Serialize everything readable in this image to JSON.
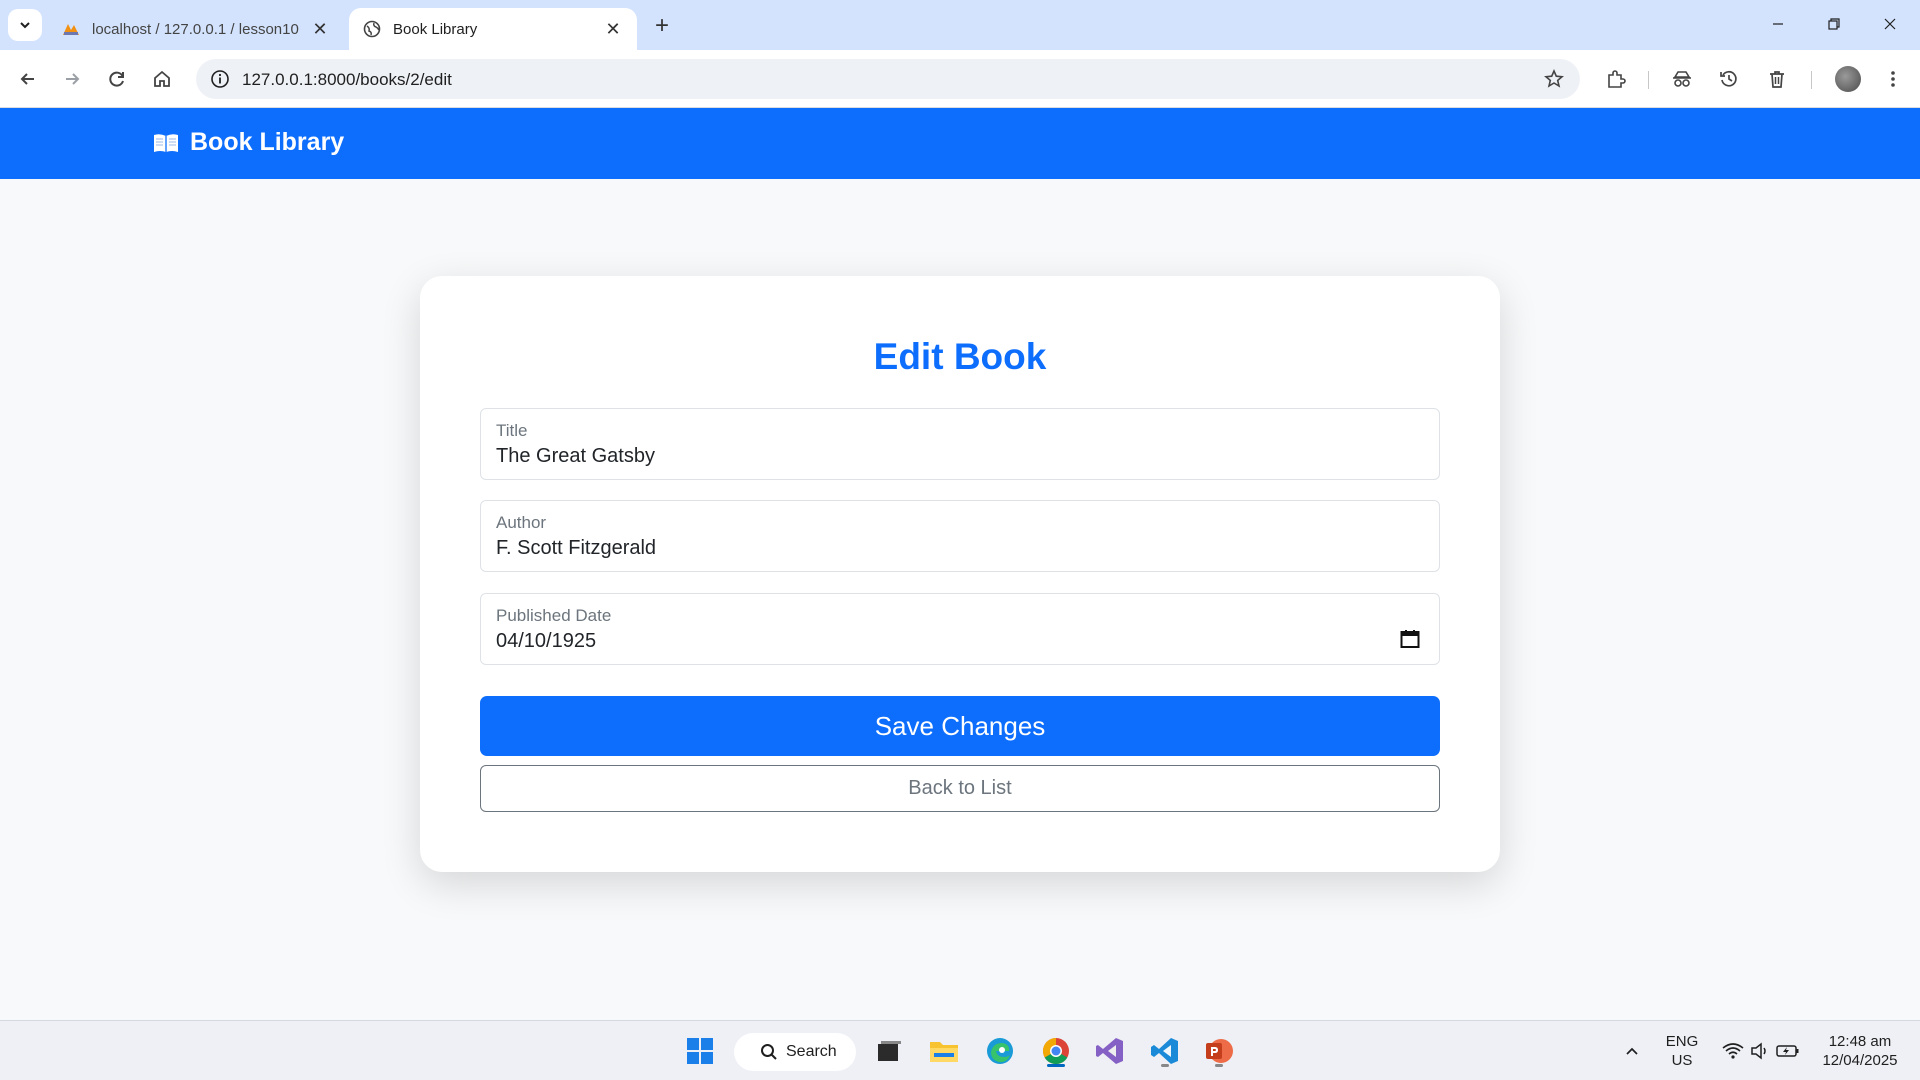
{
  "browser": {
    "tabs": [
      {
        "title": "localhost / 127.0.0.1 / lesson10",
        "active": false
      },
      {
        "title": "Book Library",
        "active": true
      }
    ],
    "url": "127.0.0.1:8000/books/2/edit"
  },
  "navbar": {
    "brand": "Book Library",
    "brand_icon": "open-book-icon",
    "color": "#0d6efd"
  },
  "form": {
    "heading": "Edit Book",
    "fields": [
      {
        "label": "Title",
        "value": "The Great Gatsby"
      },
      {
        "label": "Author",
        "value": "F. Scott Fitzgerald"
      },
      {
        "label": "Published Date",
        "value": "04/10/1925"
      }
    ],
    "save_label": "Save Changes",
    "back_label": "Back to List"
  },
  "taskbar": {
    "search_label": "Search",
    "language": "ENG",
    "region": "US",
    "time": "12:48 am",
    "date": "12/04/2025"
  }
}
